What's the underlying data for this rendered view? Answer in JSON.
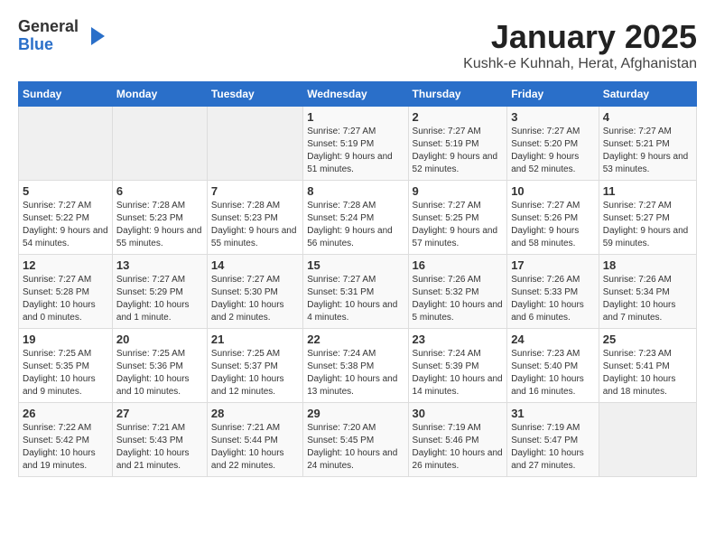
{
  "header": {
    "logo_general": "General",
    "logo_blue": "Blue",
    "month_title": "January 2025",
    "location": "Kushk-e Kuhnah, Herat, Afghanistan"
  },
  "days_of_week": [
    "Sunday",
    "Monday",
    "Tuesday",
    "Wednesday",
    "Thursday",
    "Friday",
    "Saturday"
  ],
  "weeks": [
    [
      {
        "day": "",
        "empty": true
      },
      {
        "day": "",
        "empty": true
      },
      {
        "day": "",
        "empty": true
      },
      {
        "day": "1",
        "sunrise": "7:27 AM",
        "sunset": "5:19 PM",
        "daylight": "9 hours and 51 minutes."
      },
      {
        "day": "2",
        "sunrise": "7:27 AM",
        "sunset": "5:19 PM",
        "daylight": "9 hours and 52 minutes."
      },
      {
        "day": "3",
        "sunrise": "7:27 AM",
        "sunset": "5:20 PM",
        "daylight": "9 hours and 52 minutes."
      },
      {
        "day": "4",
        "sunrise": "7:27 AM",
        "sunset": "5:21 PM",
        "daylight": "9 hours and 53 minutes."
      }
    ],
    [
      {
        "day": "5",
        "sunrise": "7:27 AM",
        "sunset": "5:22 PM",
        "daylight": "9 hours and 54 minutes."
      },
      {
        "day": "6",
        "sunrise": "7:28 AM",
        "sunset": "5:23 PM",
        "daylight": "9 hours and 55 minutes."
      },
      {
        "day": "7",
        "sunrise": "7:28 AM",
        "sunset": "5:23 PM",
        "daylight": "9 hours and 55 minutes."
      },
      {
        "day": "8",
        "sunrise": "7:28 AM",
        "sunset": "5:24 PM",
        "daylight": "9 hours and 56 minutes."
      },
      {
        "day": "9",
        "sunrise": "7:27 AM",
        "sunset": "5:25 PM",
        "daylight": "9 hours and 57 minutes."
      },
      {
        "day": "10",
        "sunrise": "7:27 AM",
        "sunset": "5:26 PM",
        "daylight": "9 hours and 58 minutes."
      },
      {
        "day": "11",
        "sunrise": "7:27 AM",
        "sunset": "5:27 PM",
        "daylight": "9 hours and 59 minutes."
      }
    ],
    [
      {
        "day": "12",
        "sunrise": "7:27 AM",
        "sunset": "5:28 PM",
        "daylight": "10 hours and 0 minutes."
      },
      {
        "day": "13",
        "sunrise": "7:27 AM",
        "sunset": "5:29 PM",
        "daylight": "10 hours and 1 minute."
      },
      {
        "day": "14",
        "sunrise": "7:27 AM",
        "sunset": "5:30 PM",
        "daylight": "10 hours and 2 minutes."
      },
      {
        "day": "15",
        "sunrise": "7:27 AM",
        "sunset": "5:31 PM",
        "daylight": "10 hours and 4 minutes."
      },
      {
        "day": "16",
        "sunrise": "7:26 AM",
        "sunset": "5:32 PM",
        "daylight": "10 hours and 5 minutes."
      },
      {
        "day": "17",
        "sunrise": "7:26 AM",
        "sunset": "5:33 PM",
        "daylight": "10 hours and 6 minutes."
      },
      {
        "day": "18",
        "sunrise": "7:26 AM",
        "sunset": "5:34 PM",
        "daylight": "10 hours and 7 minutes."
      }
    ],
    [
      {
        "day": "19",
        "sunrise": "7:25 AM",
        "sunset": "5:35 PM",
        "daylight": "10 hours and 9 minutes."
      },
      {
        "day": "20",
        "sunrise": "7:25 AM",
        "sunset": "5:36 PM",
        "daylight": "10 hours and 10 minutes."
      },
      {
        "day": "21",
        "sunrise": "7:25 AM",
        "sunset": "5:37 PM",
        "daylight": "10 hours and 12 minutes."
      },
      {
        "day": "22",
        "sunrise": "7:24 AM",
        "sunset": "5:38 PM",
        "daylight": "10 hours and 13 minutes."
      },
      {
        "day": "23",
        "sunrise": "7:24 AM",
        "sunset": "5:39 PM",
        "daylight": "10 hours and 14 minutes."
      },
      {
        "day": "24",
        "sunrise": "7:23 AM",
        "sunset": "5:40 PM",
        "daylight": "10 hours and 16 minutes."
      },
      {
        "day": "25",
        "sunrise": "7:23 AM",
        "sunset": "5:41 PM",
        "daylight": "10 hours and 18 minutes."
      }
    ],
    [
      {
        "day": "26",
        "sunrise": "7:22 AM",
        "sunset": "5:42 PM",
        "daylight": "10 hours and 19 minutes."
      },
      {
        "day": "27",
        "sunrise": "7:21 AM",
        "sunset": "5:43 PM",
        "daylight": "10 hours and 21 minutes."
      },
      {
        "day": "28",
        "sunrise": "7:21 AM",
        "sunset": "5:44 PM",
        "daylight": "10 hours and 22 minutes."
      },
      {
        "day": "29",
        "sunrise": "7:20 AM",
        "sunset": "5:45 PM",
        "daylight": "10 hours and 24 minutes."
      },
      {
        "day": "30",
        "sunrise": "7:19 AM",
        "sunset": "5:46 PM",
        "daylight": "10 hours and 26 minutes."
      },
      {
        "day": "31",
        "sunrise": "7:19 AM",
        "sunset": "5:47 PM",
        "daylight": "10 hours and 27 minutes."
      },
      {
        "day": "",
        "empty": true
      }
    ]
  ],
  "labels": {
    "sunrise": "Sunrise:",
    "sunset": "Sunset:",
    "daylight": "Daylight:"
  }
}
